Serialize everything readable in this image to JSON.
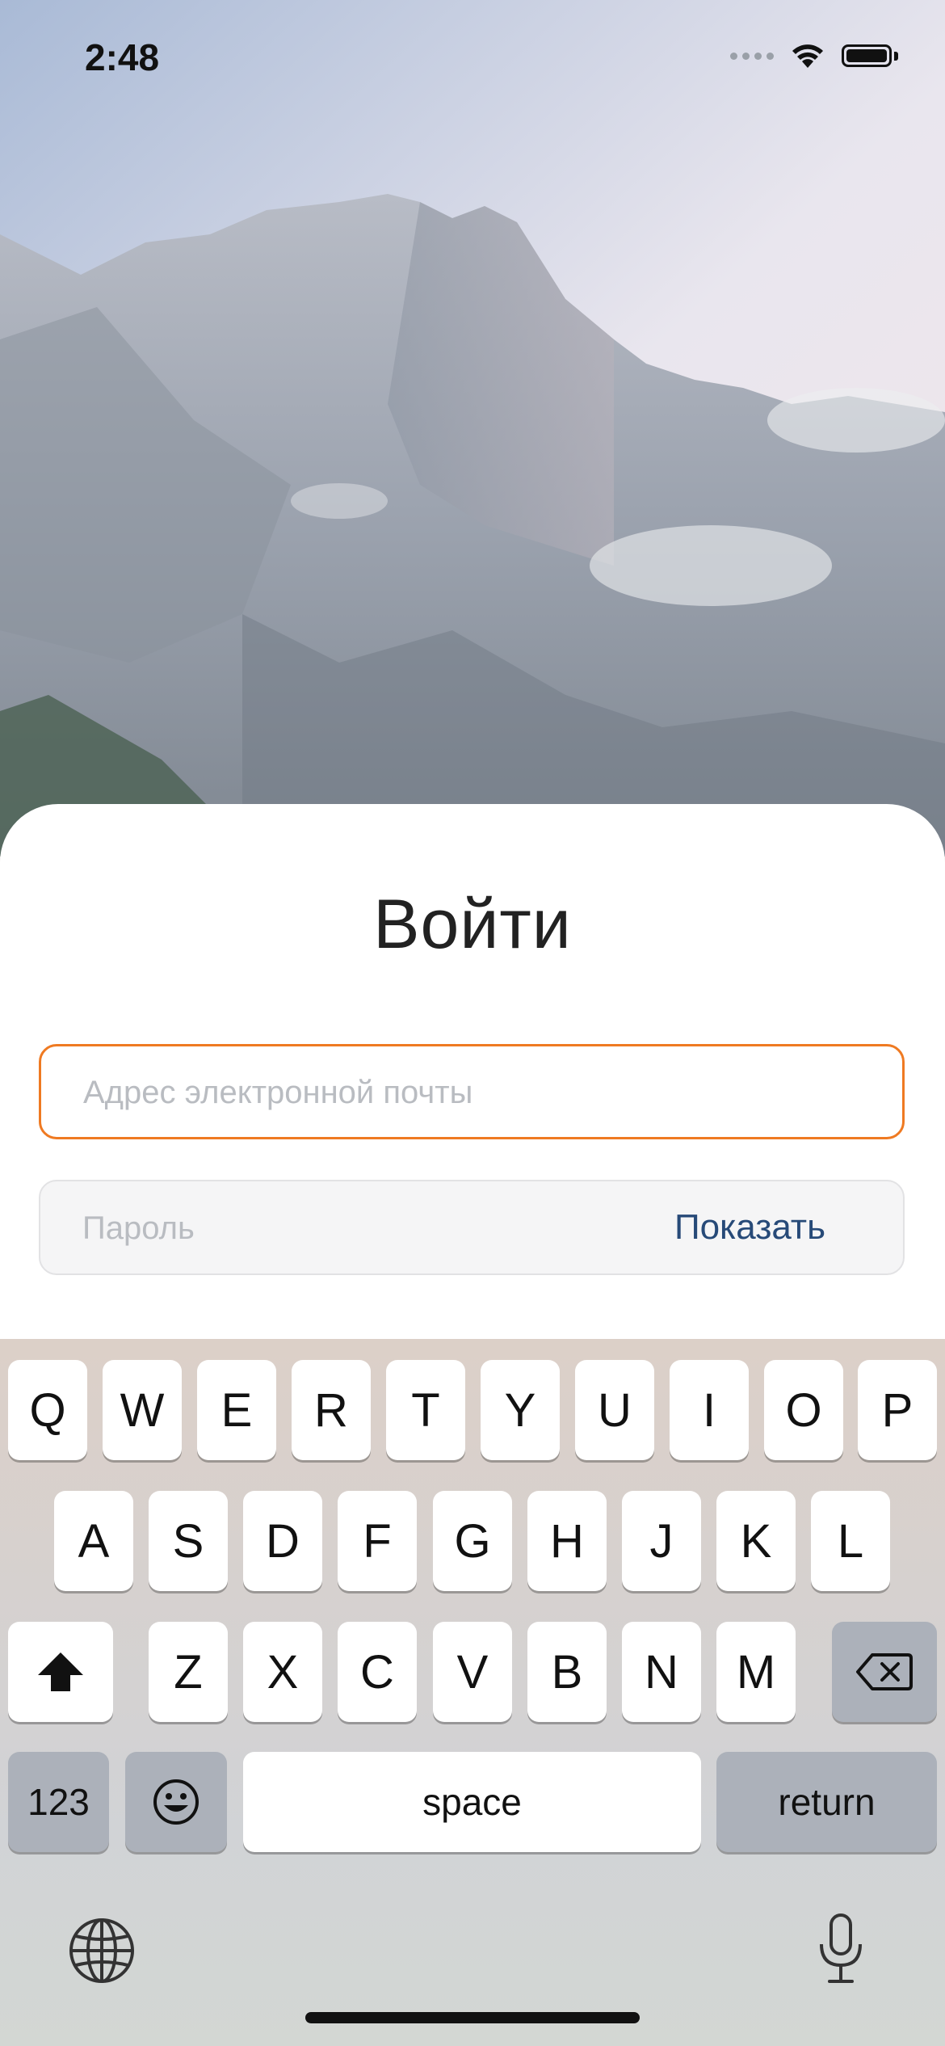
{
  "status_bar": {
    "time": "2:48"
  },
  "login": {
    "title": "Войти",
    "email_placeholder": "Адрес электронной почты",
    "password_placeholder": "Пароль",
    "show_label": "Показать"
  },
  "keyboard": {
    "row1": [
      "Q",
      "W",
      "E",
      "R",
      "T",
      "Y",
      "U",
      "I",
      "O",
      "P"
    ],
    "row2": [
      "A",
      "S",
      "D",
      "F",
      "G",
      "H",
      "J",
      "K",
      "L"
    ],
    "row3": [
      "Z",
      "X",
      "C",
      "V",
      "B",
      "N",
      "M"
    ],
    "numbers_label": "123",
    "space_label": "space",
    "return_label": "return"
  },
  "colors": {
    "accent_border": "#ef7a22",
    "link": "#274a78"
  }
}
